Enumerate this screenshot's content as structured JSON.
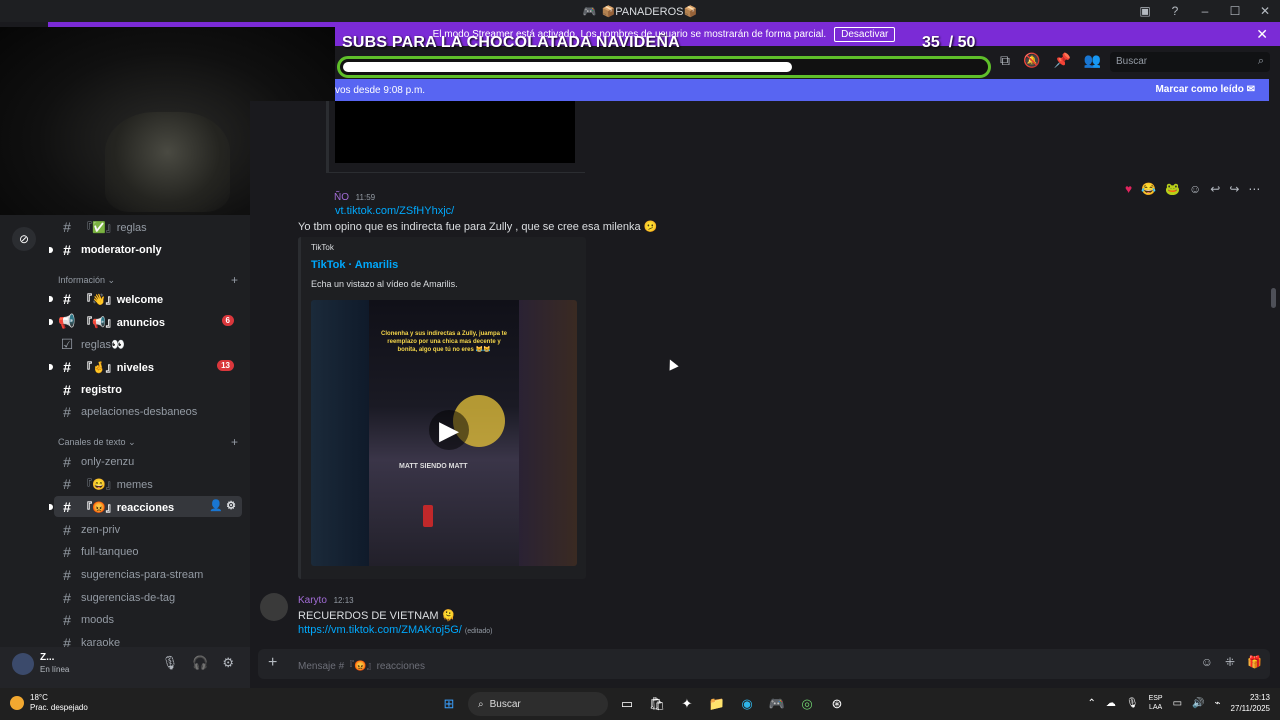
{
  "window": {
    "title": "📦PANADEROS📦"
  },
  "streamer_banner": {
    "text": "El modo Streamer está activado. Los nombres de usuario se mostrarán de forma parcial.",
    "button": "Desactivar",
    "close": "✕"
  },
  "overlay": {
    "title": "SUBS PARA LA CHOCOLATADA NAVIDEÑA",
    "count": "35",
    "separator": "/ 50",
    "progress_fraction": 0.7
  },
  "header": {
    "search_placeholder": "Buscar"
  },
  "new_messages": {
    "text": "vos desde 9:08 p.m.",
    "mark_read": "Marcar como leído"
  },
  "sidebar": {
    "channels_top": [
      {
        "name": "『✅』reglas",
        "bold": false
      },
      {
        "name": "moderator-only",
        "bold": true
      }
    ],
    "category_info": "Información",
    "info_channels": [
      {
        "name": "『👋』welcome",
        "bold": true,
        "badge": ""
      },
      {
        "name": "『📢』anuncios",
        "bold": true,
        "badge": "6"
      },
      {
        "name": "reglas👀",
        "bold": false,
        "badge": ""
      },
      {
        "name": "『🤞』niveles",
        "bold": true,
        "badge": "13"
      },
      {
        "name": "registro",
        "bold": true,
        "badge": ""
      },
      {
        "name": "apelaciones-desbaneos",
        "bold": false,
        "badge": ""
      }
    ],
    "category_text": "Canales de texto",
    "text_channels": [
      {
        "name": "only-zenzu"
      },
      {
        "name": "『😄』memes"
      },
      {
        "name": "『😡』reacciones"
      },
      {
        "name": "zen-priv"
      },
      {
        "name": "full-tanqueo"
      },
      {
        "name": "sugerencias-para-stream"
      },
      {
        "name": "sugerencias-de-tag"
      },
      {
        "name": "moods"
      },
      {
        "name": "karaoke"
      }
    ]
  },
  "user": {
    "name": "Z...",
    "status": "En línea"
  },
  "messages": {
    "first": {
      "author": "ÑO",
      "time": "11:59",
      "link": "vt.tiktok.com/ZSfHYhxjc/",
      "text": "Yo tbm opino que es indirecta fue para Zully , que se cree esa milenka 🫤",
      "embed": {
        "provider": "TikTok",
        "title": "TikTok · Amarilis",
        "description": "Echa un vistazo al vídeo de Amarilis.",
        "video_text": "Clonenha y sus indirectas a Zully, juampa te reemplazo por una chica mas decente y bonita, algo que tú no eres 😹😹",
        "caption": "MATT SIENDO MATT"
      }
    },
    "second": {
      "author": "Karyto",
      "time": "12:13",
      "text": "RECUERDOS DE VIETNAM 🫠",
      "link": "https://vm.tiktok.com/ZMAKroj5G/",
      "edited": "(editado)"
    }
  },
  "composer": {
    "placeholder": "Mensaje #『😡』reacciones"
  },
  "taskbar": {
    "temp": "18°C",
    "weather": "Prac. despejado",
    "search": "Buscar",
    "lang_top": "ESP",
    "lang_bottom": "LAA",
    "time": "23:13",
    "date": "27/11/2025"
  }
}
